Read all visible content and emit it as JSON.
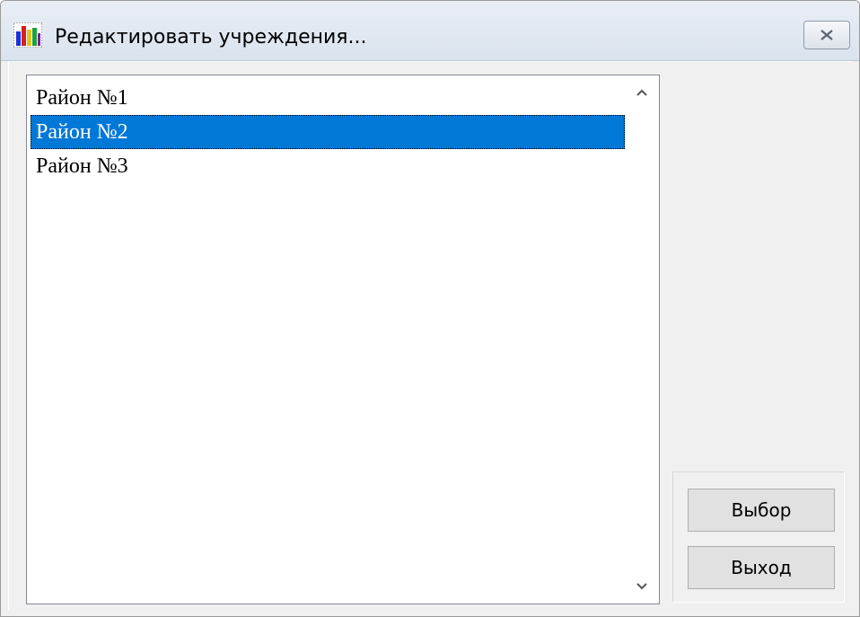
{
  "window": {
    "title": "Редактировать учреждения...",
    "icon": "bar-chart-app-icon",
    "close_icon": "close-x-icon"
  },
  "list": {
    "items": [
      {
        "label": "Район №1",
        "selected": false
      },
      {
        "label": "Район №2",
        "selected": true
      },
      {
        "label": "Район №3",
        "selected": false
      }
    ],
    "selection_color": "#0078d7"
  },
  "buttons": {
    "select_label": "Выбор",
    "exit_label": "Выход"
  }
}
